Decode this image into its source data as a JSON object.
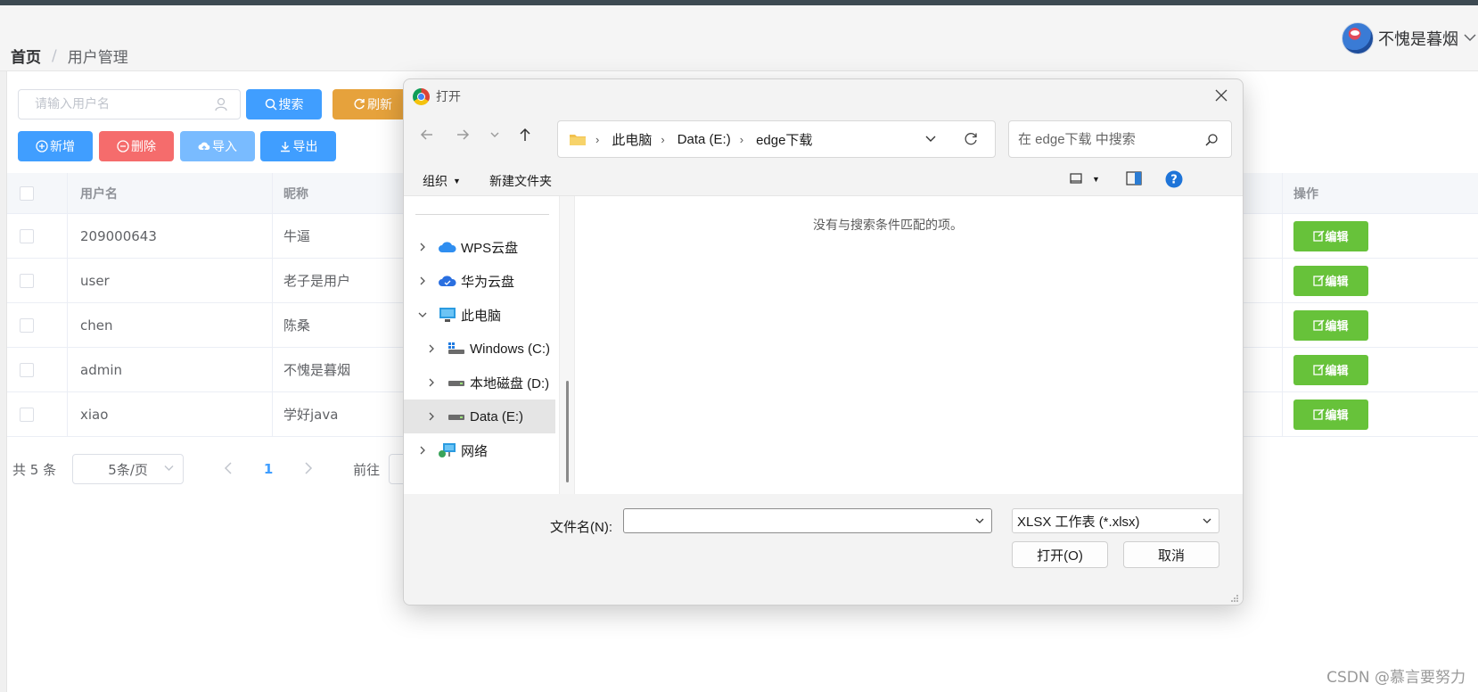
{
  "breadcrumb": {
    "home": "首页",
    "separator": "/",
    "current": "用户管理"
  },
  "user": {
    "name": "不愧是暮烟"
  },
  "toolbar": {
    "search_placeholder": "请输入用户名",
    "search_label": "搜索",
    "refresh_label": "刷新",
    "add_label": "新增",
    "delete_label": "删除",
    "import_label": "导入",
    "export_label": "导出"
  },
  "table": {
    "columns": {
      "username": "用户名",
      "nickname": "昵称",
      "actions": "操作"
    },
    "edit_label": "编辑",
    "rows": [
      {
        "username": "209000643",
        "nickname": "牛逼"
      },
      {
        "username": "user",
        "nickname": "老子是用户"
      },
      {
        "username": "chen",
        "nickname": "陈桑"
      },
      {
        "username": "admin",
        "nickname": "不愧是暮烟"
      },
      {
        "username": "xiao",
        "nickname": "学好java"
      }
    ]
  },
  "pagination": {
    "total": "共 5 条",
    "page_size": "5条/页",
    "current_page": "1",
    "goto": "前往"
  },
  "dialog": {
    "title": "打开",
    "path": [
      "此电脑",
      "Data (E:)",
      "edge下载"
    ],
    "search_placeholder": "在 edge下载 中搜索",
    "organize": "组织",
    "new_folder": "新建文件夹",
    "nav_tree": [
      {
        "label": "WPS云盘",
        "icon": "cloud-icon",
        "expanded": false
      },
      {
        "label": "华为云盘",
        "icon": "cloud-icon",
        "expanded": false
      },
      {
        "label": "此电脑",
        "icon": "computer-icon",
        "expanded": true
      },
      {
        "label": "Windows (C:)",
        "icon": "drive-icon",
        "expanded": false
      },
      {
        "label": "本地磁盘 (D:)",
        "icon": "drive-icon",
        "expanded": false
      },
      {
        "label": "Data (E:)",
        "icon": "drive-icon",
        "expanded": false,
        "selected": true
      },
      {
        "label": "网络",
        "icon": "network-icon",
        "expanded": false
      }
    ],
    "empty_message": "没有与搜索条件匹配的项。",
    "filename_label": "文件名(N):",
    "filename_value": "",
    "filetype": "XLSX 工作表 (*.xlsx)",
    "open_label": "打开(O)",
    "cancel_label": "取消"
  },
  "watermark": "CSDN @慕言要努力",
  "colors": {
    "primary": "#409eff",
    "warning": "#e6a23c",
    "danger": "#f56c6c",
    "success": "#67c23a"
  }
}
